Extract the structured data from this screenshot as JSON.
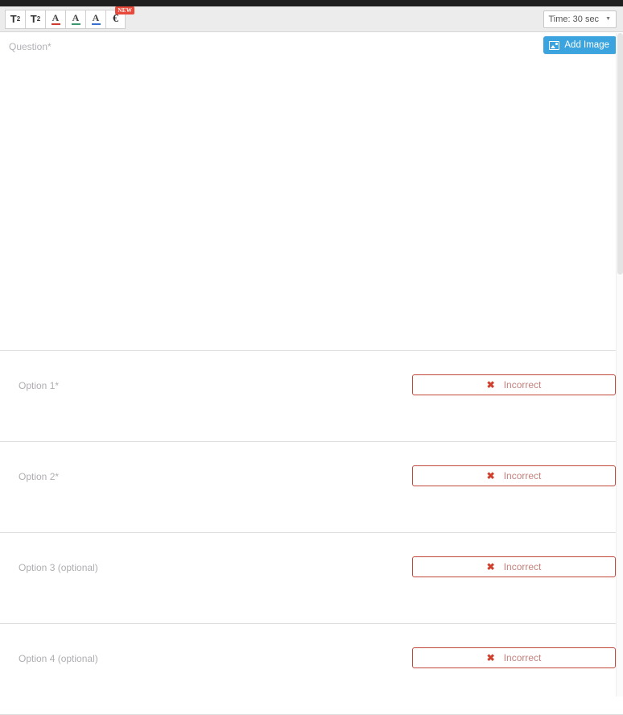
{
  "toolbar": {
    "buttons": [
      {
        "name": "superscript-button",
        "label": "T",
        "script": "2",
        "type": "superscript"
      },
      {
        "name": "subscript-button",
        "label": "T",
        "script": "2",
        "type": "subscript"
      },
      {
        "name": "text-color-red-button",
        "label": "A",
        "color": "#cf3b2e",
        "type": "color"
      },
      {
        "name": "text-color-green-button",
        "label": "A",
        "color": "#3a9a6e",
        "type": "color"
      },
      {
        "name": "text-color-blue-button",
        "label": "A",
        "color": "#3b6fcf",
        "type": "color"
      },
      {
        "name": "equation-button",
        "label": "€",
        "type": "equation",
        "badge": "NEW"
      }
    ],
    "badge_label": "NEW",
    "badge_color": "#e8493a"
  },
  "time_select": {
    "value": "Time: 30 sec",
    "caret": "▼"
  },
  "question": {
    "placeholder": "Question*",
    "add_image_label": "Add Image",
    "add_image_color": "#3ba3dd"
  },
  "options": [
    {
      "placeholder": "Option 1*",
      "verdict": "Incorrect",
      "verdict_icon": "✖"
    },
    {
      "placeholder": "Option 2*",
      "verdict": "Incorrect",
      "verdict_icon": "✖"
    },
    {
      "placeholder": "Option 3 (optional)",
      "verdict": "Incorrect",
      "verdict_icon": "✖"
    },
    {
      "placeholder": "Option 4 (optional)",
      "verdict": "Incorrect",
      "verdict_icon": "✖"
    }
  ]
}
